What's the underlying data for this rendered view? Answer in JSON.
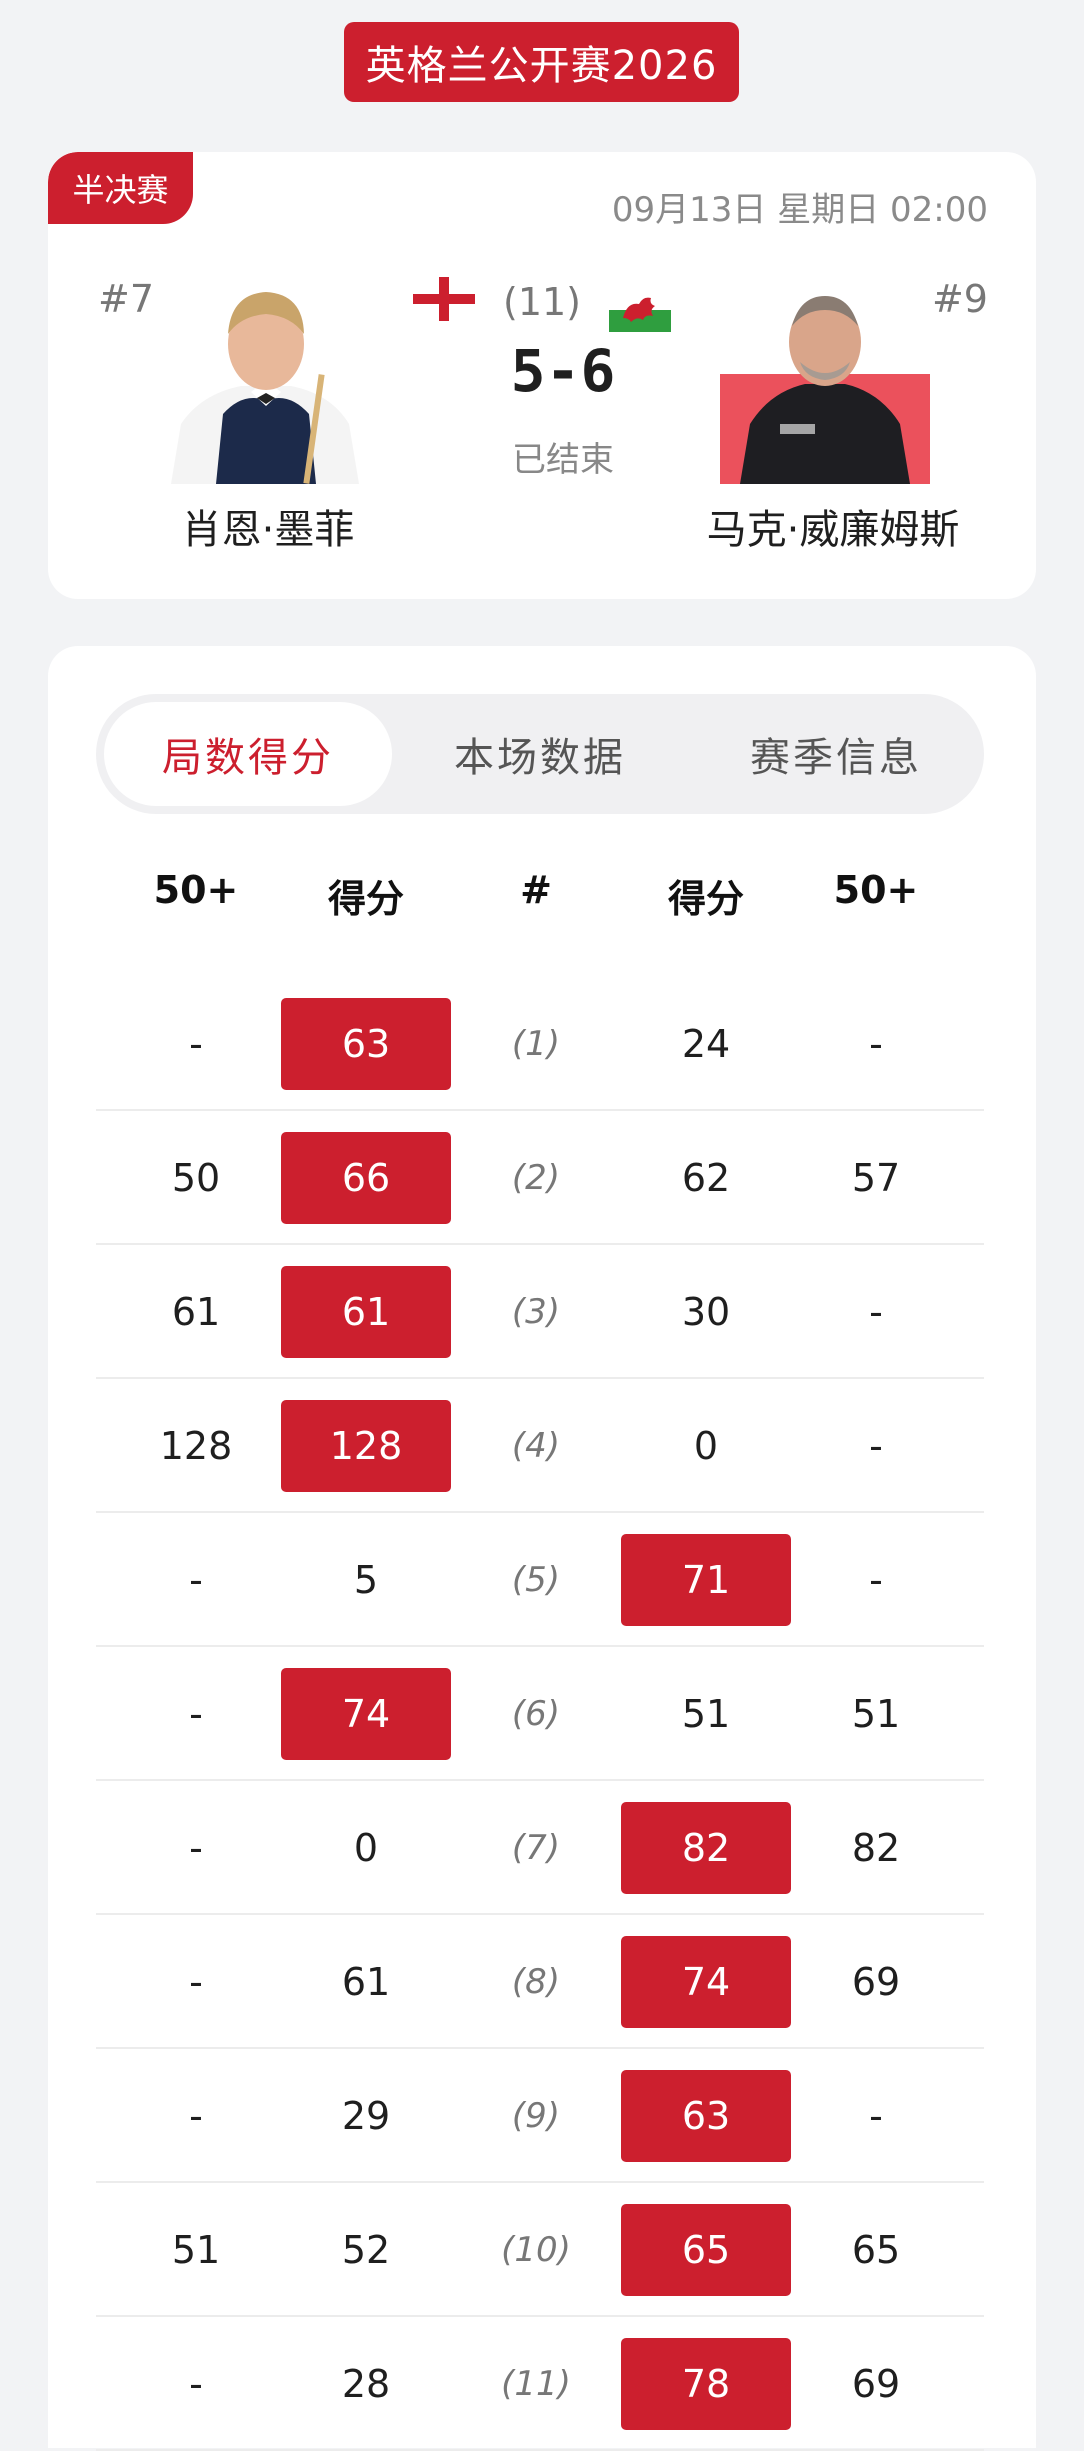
{
  "event": {
    "title": "英格兰公开赛2026"
  },
  "match": {
    "round": "半决赛",
    "time": "09月13日 星期日 02:00",
    "best_of": "(11)",
    "score": "5-6",
    "status": "已结束",
    "player1": {
      "seed": "#7",
      "name": "肖恩·墨菲",
      "flag": "england-flag"
    },
    "player2": {
      "seed": "#9",
      "name": "马克·威廉姆斯",
      "flag": "wales-flag"
    }
  },
  "tabs": [
    {
      "label": "局数得分",
      "active": true
    },
    {
      "label": "本场数据",
      "active": false
    },
    {
      "label": "赛季信息",
      "active": false
    }
  ],
  "table": {
    "headers": [
      "50+",
      "得分",
      "#",
      "得分",
      "50+"
    ],
    "rows": [
      {
        "p1_50": "-",
        "p1_score": "63",
        "frame": "(1)",
        "p2_score": "24",
        "p2_50": "-",
        "winner": "p1"
      },
      {
        "p1_50": "50",
        "p1_score": "66",
        "frame": "(2)",
        "p2_score": "62",
        "p2_50": "57",
        "winner": "p1"
      },
      {
        "p1_50": "61",
        "p1_score": "61",
        "frame": "(3)",
        "p2_score": "30",
        "p2_50": "-",
        "winner": "p1"
      },
      {
        "p1_50": "128",
        "p1_score": "128",
        "frame": "(4)",
        "p2_score": "0",
        "p2_50": "-",
        "winner": "p1"
      },
      {
        "p1_50": "-",
        "p1_score": "5",
        "frame": "(5)",
        "p2_score": "71",
        "p2_50": "-",
        "winner": "p2"
      },
      {
        "p1_50": "-",
        "p1_score": "74",
        "frame": "(6)",
        "p2_score": "51",
        "p2_50": "51",
        "winner": "p1"
      },
      {
        "p1_50": "-",
        "p1_score": "0",
        "frame": "(7)",
        "p2_score": "82",
        "p2_50": "82",
        "winner": "p2"
      },
      {
        "p1_50": "-",
        "p1_score": "61",
        "frame": "(8)",
        "p2_score": "74",
        "p2_50": "69",
        "winner": "p2"
      },
      {
        "p1_50": "-",
        "p1_score": "29",
        "frame": "(9)",
        "p2_score": "63",
        "p2_50": "-",
        "winner": "p2"
      },
      {
        "p1_50": "51",
        "p1_score": "52",
        "frame": "(10)",
        "p2_score": "65",
        "p2_50": "65",
        "winner": "p2"
      },
      {
        "p1_50": "-",
        "p1_score": "28",
        "frame": "(11)",
        "p2_score": "78",
        "p2_50": "69",
        "winner": "p2"
      }
    ]
  },
  "colors": {
    "accent": "#cc1f2e",
    "background": "#f2f3f5"
  }
}
